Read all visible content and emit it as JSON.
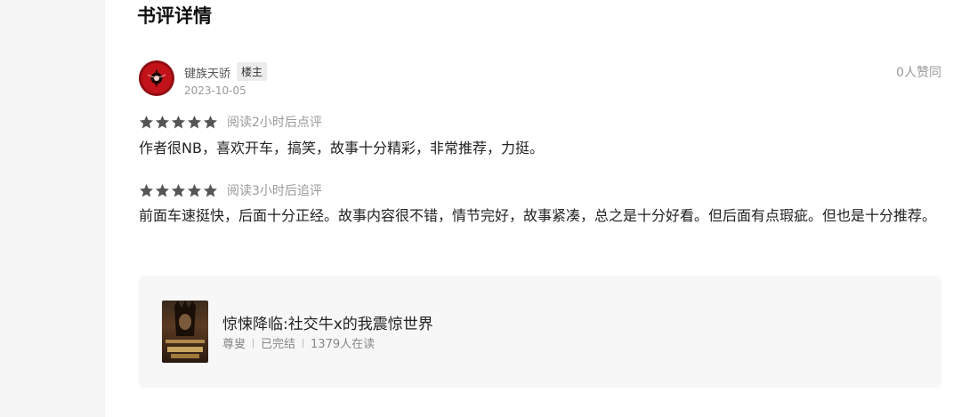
{
  "page": {
    "title": "书评详情"
  },
  "review": {
    "author": "键族天骄",
    "badge": "楼主",
    "date": "2023-10-05",
    "likes": "0人赞同",
    "entries": [
      {
        "stars": 5,
        "note": "阅读2小时后点评",
        "text": "作者很NB，喜欢开车，搞笑，故事十分精彩，非常推荐，力挺。"
      },
      {
        "stars": 5,
        "note": "阅读3小时后追评",
        "text": "前面车速挺快，后面十分正经。故事内容很不错，情节完好，故事紧凑，总之是十分好看。但后面有点瑕疵。但也是十分推荐。"
      }
    ]
  },
  "book": {
    "title": "惊悚降临:社交牛x的我震惊世界",
    "author": "尊叟",
    "status": "已完结",
    "readers": "1379人在读"
  },
  "colors": {
    "star": "#555555",
    "panel": "#ffffff",
    "gutter": "#f5f5f5"
  }
}
